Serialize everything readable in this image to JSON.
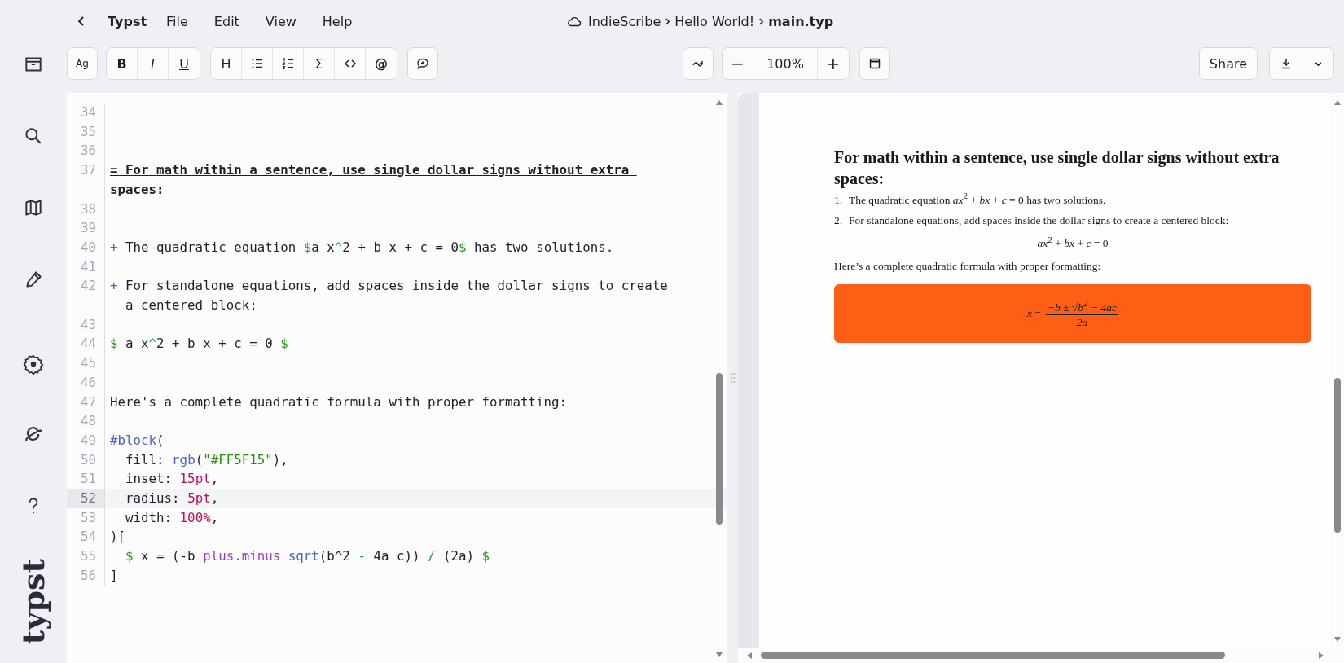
{
  "menu": {
    "app_name": "Typst",
    "items": [
      "File",
      "Edit",
      "View",
      "Help"
    ],
    "breadcrumb": [
      "IndieScribe",
      "Hello World!",
      "main.typ"
    ]
  },
  "toolbar": {
    "font_button": "Ag",
    "format_buttons": [
      "B",
      "I",
      "U"
    ],
    "heading_button": "H",
    "math_button": "Σ",
    "mention_button": "@",
    "zoom": {
      "out": "−",
      "level": "100%",
      "in": "+"
    },
    "share": "Share"
  },
  "editor": {
    "lines": [
      {
        "number": "34",
        "kind": "blank",
        "highlighted": false
      },
      {
        "number": "35",
        "kind": "blank",
        "highlighted": false
      },
      {
        "number": "36",
        "kind": "blank",
        "highlighted": false
      },
      {
        "number": "37",
        "kind": "text",
        "highlighted": false,
        "tokens": [
          {
            "kind": "heading",
            "text": "= For math within a sentence, use single dollar signs without extra spaces:"
          }
        ]
      },
      {
        "number": "38",
        "kind": "blank",
        "highlighted": false
      },
      {
        "number": "39",
        "kind": "blank",
        "highlighted": false
      },
      {
        "number": "40",
        "kind": "list",
        "highlighted": false,
        "tokens": [
          {
            "kind": "marker",
            "text": "+"
          },
          {
            "kind": "plain",
            "text": " The quadratic equation "
          },
          {
            "kind": "math",
            "text": "$"
          },
          {
            "kind": "plain",
            "text": "a x"
          },
          {
            "kind": "op",
            "text": "^"
          },
          {
            "kind": "plain",
            "text": "2 + b x + c = 0"
          },
          {
            "kind": "math",
            "text": "$"
          },
          {
            "kind": "plain",
            "text": " has two solutions."
          }
        ]
      },
      {
        "number": "41",
        "kind": "blank",
        "highlighted": false
      },
      {
        "number": "42",
        "kind": "list",
        "highlighted": false,
        "tokens": [
          {
            "kind": "marker",
            "text": "+"
          },
          {
            "kind": "plain",
            "text": " For standalone equations, add spaces inside the dollar signs to create a centered block:"
          }
        ]
      },
      {
        "number": "43",
        "kind": "blank",
        "highlighted": false
      },
      {
        "number": "44",
        "kind": "text",
        "highlighted": false,
        "tokens": [
          {
            "kind": "math",
            "text": "$"
          },
          {
            "kind": "plain",
            "text": " a x"
          },
          {
            "kind": "op",
            "text": "^"
          },
          {
            "kind": "plain",
            "text": "2 + b x + c = 0 "
          },
          {
            "kind": "math",
            "text": "$"
          }
        ]
      },
      {
        "number": "45",
        "kind": "blank",
        "highlighted": false
      },
      {
        "number": "46",
        "kind": "blank",
        "highlighted": false
      },
      {
        "number": "47",
        "kind": "text",
        "highlighted": false,
        "tokens": [
          {
            "kind": "plain",
            "text": "Here's a complete quadratic formula with proper formatting:"
          }
        ]
      },
      {
        "number": "48",
        "kind": "blank",
        "highlighted": false
      },
      {
        "number": "49",
        "kind": "text",
        "highlighted": false,
        "tokens": [
          {
            "kind": "func",
            "text": "#block"
          },
          {
            "kind": "plain",
            "text": "("
          }
        ]
      },
      {
        "number": "50",
        "kind": "text",
        "highlighted": false,
        "tokens": [
          {
            "kind": "plain",
            "text": "  fill: "
          },
          {
            "kind": "func",
            "text": "rgb"
          },
          {
            "kind": "plain",
            "text": "("
          },
          {
            "kind": "string",
            "text": "\"#FF5F15\""
          },
          {
            "kind": "plain",
            "text": "),"
          }
        ]
      },
      {
        "number": "51",
        "kind": "text",
        "highlighted": false,
        "tokens": [
          {
            "kind": "plain",
            "text": "  inset: "
          },
          {
            "kind": "number",
            "text": "15pt"
          },
          {
            "kind": "plain",
            "text": ","
          }
        ]
      },
      {
        "number": "52",
        "kind": "text",
        "highlighted": true,
        "tokens": [
          {
            "kind": "plain",
            "text": "  radius: "
          },
          {
            "kind": "number",
            "text": "5pt"
          },
          {
            "kind": "plain",
            "text": ","
          }
        ]
      },
      {
        "number": "53",
        "kind": "text",
        "highlighted": false,
        "tokens": [
          {
            "kind": "plain",
            "text": "  width: "
          },
          {
            "kind": "number",
            "text": "100%"
          },
          {
            "kind": "plain",
            "text": ","
          }
        ]
      },
      {
        "number": "54",
        "kind": "text",
        "highlighted": false,
        "tokens": [
          {
            "kind": "plain",
            "text": ")["
          }
        ]
      },
      {
        "number": "55",
        "kind": "text",
        "highlighted": false,
        "tokens": [
          {
            "kind": "math",
            "text": "  $"
          },
          {
            "kind": "plain",
            "text": " x = (-b "
          },
          {
            "kind": "keyword",
            "text": "plus.minus "
          },
          {
            "kind": "func",
            "text": "sqrt"
          },
          {
            "kind": "plain",
            "text": "(b^2 "
          },
          {
            "kind": "op",
            "text": "-"
          },
          {
            "kind": "plain",
            "text": " 4a c)) "
          },
          {
            "kind": "op",
            "text": "/"
          },
          {
            "kind": "plain",
            "text": " (2a) "
          },
          {
            "kind": "math",
            "text": "$"
          }
        ]
      },
      {
        "number": "56",
        "kind": "text",
        "highlighted": false,
        "tokens": [
          {
            "kind": "plain",
            "text": "]"
          }
        ]
      }
    ]
  },
  "preview": {
    "heading": "For math within a sentence, use single dollar signs without extra spaces:",
    "list": [
      {
        "marker": "1.",
        "text": "The quadratic equation *ax*$^{2}$ + *bx* + *c* = 0 has two solutions."
      },
      {
        "marker": "2.",
        "text": "For standalone equations, add spaces inside the dollar signs to create a centered block:"
      }
    ],
    "display_math": "*ax*$^{2}$ + *bx* + *c* = 0",
    "paragraph": "Here’s a complete quadratic formula with proper formatting:",
    "block": {
      "lhs": "*x* =",
      "numerator": "−b ± √b$^{2}$ − 4ac",
      "denominator": "2a"
    }
  },
  "sidebar": {
    "logo": "typst"
  }
}
